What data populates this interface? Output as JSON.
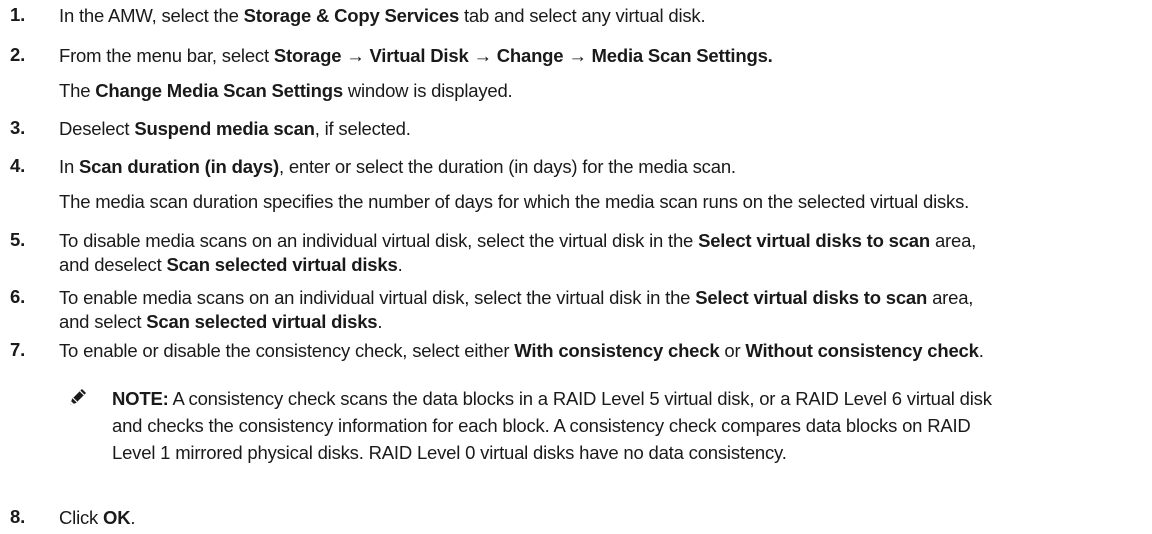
{
  "steps": [
    {
      "num": "1.",
      "t1": "In the AMW, select the ",
      "b1": "Storage & Copy Services",
      "t2": " tab and select any virtual disk."
    },
    {
      "num": "2.",
      "t1": "From the menu bar, select ",
      "b1": "Storage → Virtual Disk → Change → Media Scan Settings.",
      "sub_b": "Change Media Scan Settings",
      "sub_t1": "The ",
      "sub_t2": " window is displayed."
    },
    {
      "num": "3.",
      "t1": "Deselect ",
      "b1": "Suspend media scan",
      "t2": ", if selected."
    },
    {
      "num": "4.",
      "t1": "In ",
      "b1": "Scan duration (in days)",
      "t2": ", enter or select the duration (in days) for the media scan.",
      "sub": "The media scan duration specifies the number of days for which the media scan runs on the selected virtual disks."
    },
    {
      "num": "5.",
      "t1": "To disable media scans on an individual virtual disk, select the virtual disk in the ",
      "b1": "Select virtual disks to scan",
      "t2": " area,",
      "t3": "and deselect ",
      "b2": "Scan selected virtual disks",
      "t4": "."
    },
    {
      "num": "6.",
      "t1": "To enable media scans on an individual virtual disk, select the virtual disk in the ",
      "b1": "Select virtual disks to scan",
      "t2": " area,",
      "t3": "and select ",
      "b2": "Scan selected virtual disks",
      "t4": "."
    },
    {
      "num": "7.",
      "t1": "To enable or disable the consistency check, select either ",
      "b1": "With consistency check",
      "t2": " or ",
      "b2": "Without consistency check",
      "t3": "."
    },
    {
      "num": "8.",
      "t1": "Click ",
      "b1": "OK",
      "t2": "."
    }
  ],
  "note": {
    "label": "NOTE:",
    "line1": " A consistency check scans the data blocks in a RAID Level 5 virtual disk, or a RAID Level 6 virtual disk",
    "line2": "and checks the consistency information for each block. A consistency check compares data blocks on RAID",
    "line3": "Level 1 mirrored physical disks. RAID Level 0 virtual disks have no data consistency.",
    "icon": "pencil-icon"
  }
}
